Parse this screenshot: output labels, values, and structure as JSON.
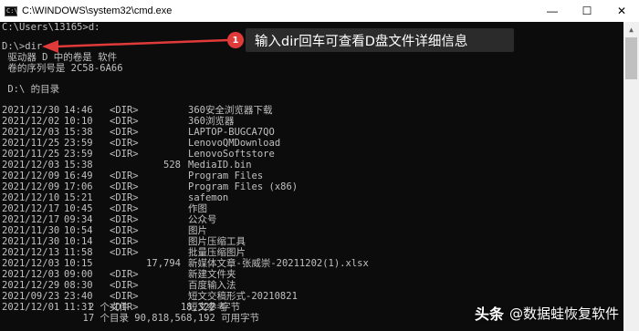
{
  "window": {
    "title": "C:\\WINDOWS\\system32\\cmd.exe",
    "icon_text": "C:\\",
    "minimize": "—",
    "maximize": "☐",
    "close": "✕"
  },
  "console": {
    "prompt_line": "C:\\Users\\13165>d:",
    "dir_command": "D:\\>dir",
    "volume_line": " 驱动器 D 中的卷是 软件",
    "serial_line": " 卷的序列号是 2C58-6A66",
    "dir_of": " D:\\ 的目录",
    "entries": [
      {
        "date": "2021/12/30",
        "time": "14:46",
        "kind": "<DIR>",
        "size": "",
        "name": "360安全浏览器下载"
      },
      {
        "date": "2021/12/02",
        "time": "10:10",
        "kind": "<DIR>",
        "size": "",
        "name": "360浏览器"
      },
      {
        "date": "2021/12/03",
        "time": "15:38",
        "kind": "<DIR>",
        "size": "",
        "name": "LAPTOP-BUGCA7QO"
      },
      {
        "date": "2021/11/25",
        "time": "23:59",
        "kind": "<DIR>",
        "size": "",
        "name": "LenovoQMDownload"
      },
      {
        "date": "2021/11/25",
        "time": "23:59",
        "kind": "<DIR>",
        "size": "",
        "name": "LenovoSoftstore"
      },
      {
        "date": "2021/12/03",
        "time": "15:38",
        "kind": "",
        "size": "528",
        "name": "MediaID.bin"
      },
      {
        "date": "2021/12/09",
        "time": "16:49",
        "kind": "<DIR>",
        "size": "",
        "name": "Program Files"
      },
      {
        "date": "2021/12/09",
        "time": "17:06",
        "kind": "<DIR>",
        "size": "",
        "name": "Program Files (x86)"
      },
      {
        "date": "2021/12/10",
        "time": "15:21",
        "kind": "<DIR>",
        "size": "",
        "name": "safemon"
      },
      {
        "date": "2021/12/17",
        "time": "10:45",
        "kind": "<DIR>",
        "size": "",
        "name": "作图"
      },
      {
        "date": "2021/12/17",
        "time": "09:34",
        "kind": "<DIR>",
        "size": "",
        "name": "公众号"
      },
      {
        "date": "2021/11/30",
        "time": "10:54",
        "kind": "<DIR>",
        "size": "",
        "name": "图片"
      },
      {
        "date": "2021/11/30",
        "time": "10:14",
        "kind": "<DIR>",
        "size": "",
        "name": "图片压缩工具"
      },
      {
        "date": "2021/12/13",
        "time": "11:58",
        "kind": "<DIR>",
        "size": "",
        "name": "批量压缩图片"
      },
      {
        "date": "2021/12/03",
        "time": "10:15",
        "kind": "",
        "size": "17,794",
        "name": "新媒体文章-张威崇-20211202(1).xlsx"
      },
      {
        "date": "2021/12/03",
        "time": "09:00",
        "kind": "<DIR>",
        "size": "",
        "name": "新建文件夹"
      },
      {
        "date": "2021/12/29",
        "time": "08:30",
        "kind": "<DIR>",
        "size": "",
        "name": "百度输入法"
      },
      {
        "date": "2021/09/23",
        "time": "23:40",
        "kind": "<DIR>",
        "size": "",
        "name": "短文交稿形式-20210821"
      },
      {
        "date": "2021/12/01",
        "time": "11:31",
        "kind": "<DIR>",
        "size": "",
        "name": "短文参考"
      }
    ],
    "files_summary": "               2 个文件         18,322 字节",
    "dirs_summary": "              17 个目录 90,818,568,192 可用字节"
  },
  "annotation": {
    "number": "1",
    "text": "输入dir回车可查看D盘文件详细信息",
    "color": "#e03a3a"
  },
  "watermark": {
    "brand": "头条",
    "text": "@数据蛙恢复软件"
  }
}
